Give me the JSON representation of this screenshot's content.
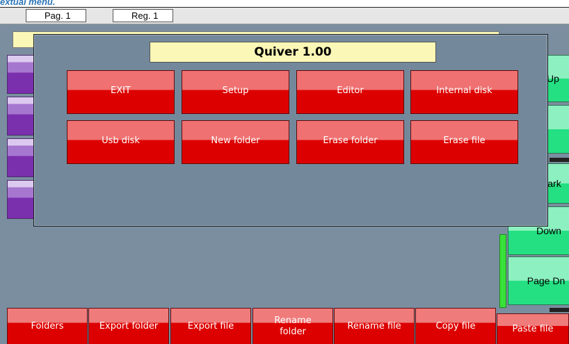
{
  "caption": "extual menu.",
  "topbar": {
    "page_label": "Pag. 1",
    "reg_label": "Reg. 1"
  },
  "dialog": {
    "title": "Quiver 1.00",
    "buttons": [
      "EXIT",
      "Setup",
      "Editor",
      "Internal disk",
      "Usb disk",
      "New folder",
      "Erase folder",
      "Erase file"
    ]
  },
  "right_panel": {
    "up": "Up",
    "mark": "ark",
    "down": "Down",
    "page_down": "Page Dn"
  },
  "bottom": {
    "folders": "Folders",
    "export_folder": "Export folder",
    "export_file": "Export file",
    "rename_folder": "Rename\nfolder",
    "rename_file": "Rename file",
    "copy_file": "Copy file",
    "paste_file": "Paste file"
  },
  "colors": {
    "red_button": "#dd0000",
    "green_button": "#24e082",
    "dialog_bg": "#74889b",
    "title_bg": "#fbf7b6",
    "purple_tab": "#7a2fad"
  }
}
